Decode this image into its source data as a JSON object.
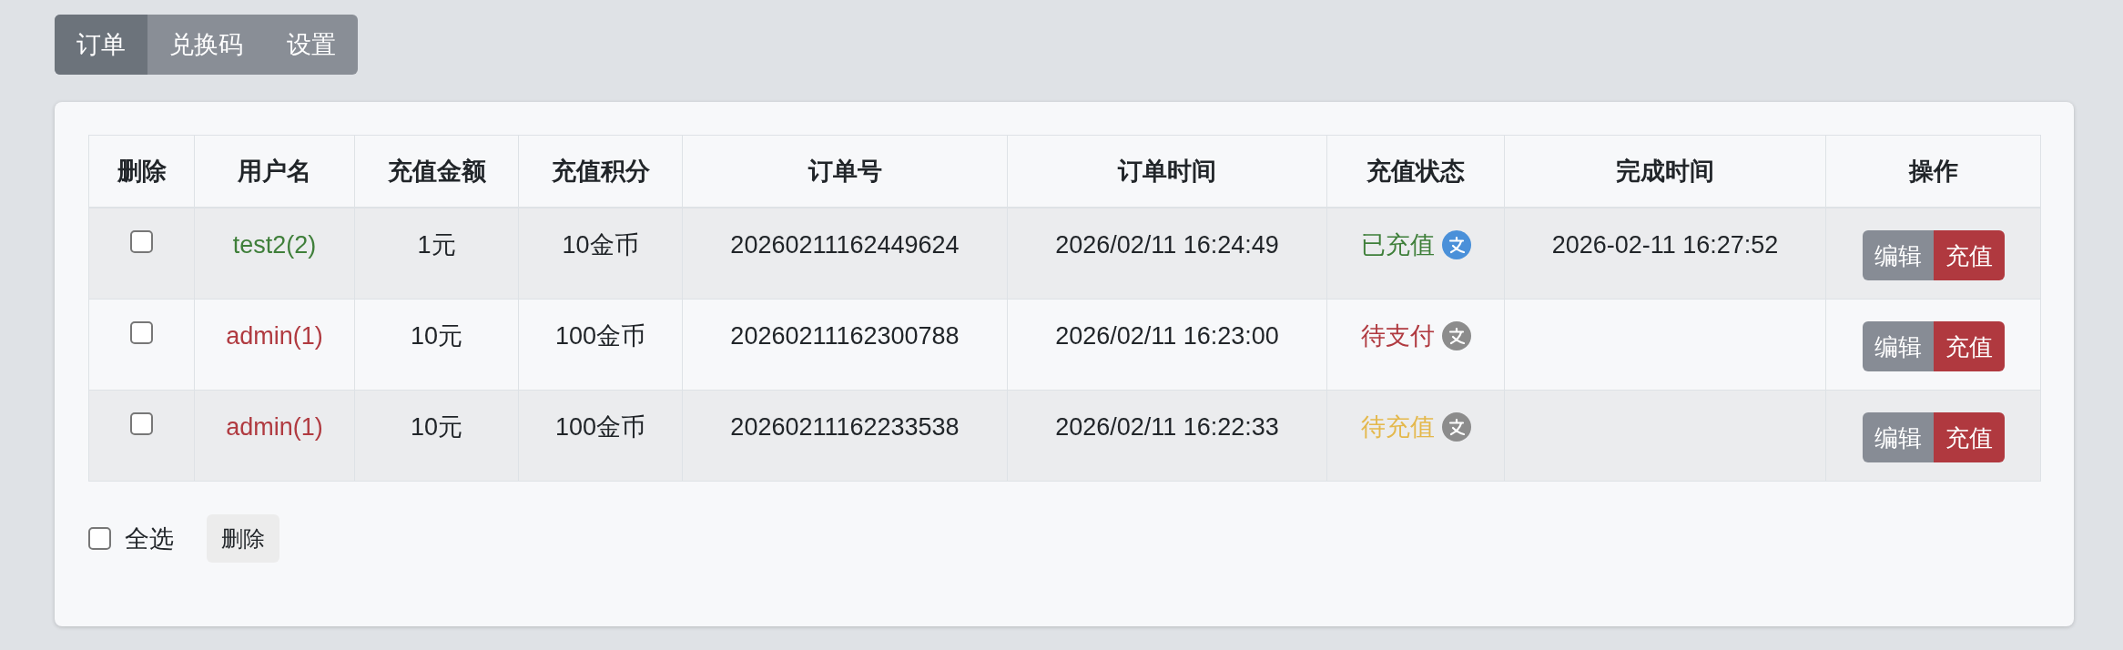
{
  "tabs": [
    {
      "label": "订单",
      "selected": true
    },
    {
      "label": "兑换码",
      "selected": false
    },
    {
      "label": "设置",
      "selected": false
    }
  ],
  "table": {
    "columns": [
      "删除",
      "用户名",
      "充值金额",
      "充值积分",
      "订单号",
      "订单时间",
      "充值状态",
      "完成时间",
      "操作"
    ],
    "rows": [
      {
        "checked": false,
        "username": {
          "text": "test2(2)",
          "color": "#3f7f3a"
        },
        "amount": "1元",
        "points": "10金币",
        "order_no": "20260211162449624",
        "order_time": "2026/02/11 16:24:49",
        "status": {
          "text": "已充值",
          "color": "#3f7f3a",
          "icon_active": true
        },
        "completed_time": "2026-02-11 16:27:52",
        "actions": [
          {
            "label": "编辑",
            "kind": "edit"
          },
          {
            "label": "充值",
            "kind": "charge"
          }
        ]
      },
      {
        "checked": false,
        "username": {
          "text": "admin(1)",
          "color": "#b03a40"
        },
        "amount": "10元",
        "points": "100金币",
        "order_no": "20260211162300788",
        "order_time": "2026/02/11 16:23:00",
        "status": {
          "text": "待支付",
          "color": "#b03a40",
          "icon_active": false
        },
        "actions": [
          {
            "label": "编辑",
            "kind": "edit"
          },
          {
            "label": "充值",
            "kind": "charge"
          }
        ]
      },
      {
        "checked": false,
        "username": {
          "text": "admin(1)",
          "color": "#b03a40"
        },
        "amount": "10元",
        "points": "100金币",
        "order_no": "20260211162233538",
        "order_time": "2026/02/11 16:22:33",
        "status": {
          "text": "待充值",
          "color": "#e4b84c",
          "icon_active": false
        },
        "actions": [
          {
            "label": "编辑",
            "kind": "edit"
          },
          {
            "label": "充值",
            "kind": "charge"
          }
        ]
      }
    ]
  },
  "footer": {
    "select_all": {
      "label": "全选",
      "checked": false
    },
    "delete_label": "删除"
  }
}
